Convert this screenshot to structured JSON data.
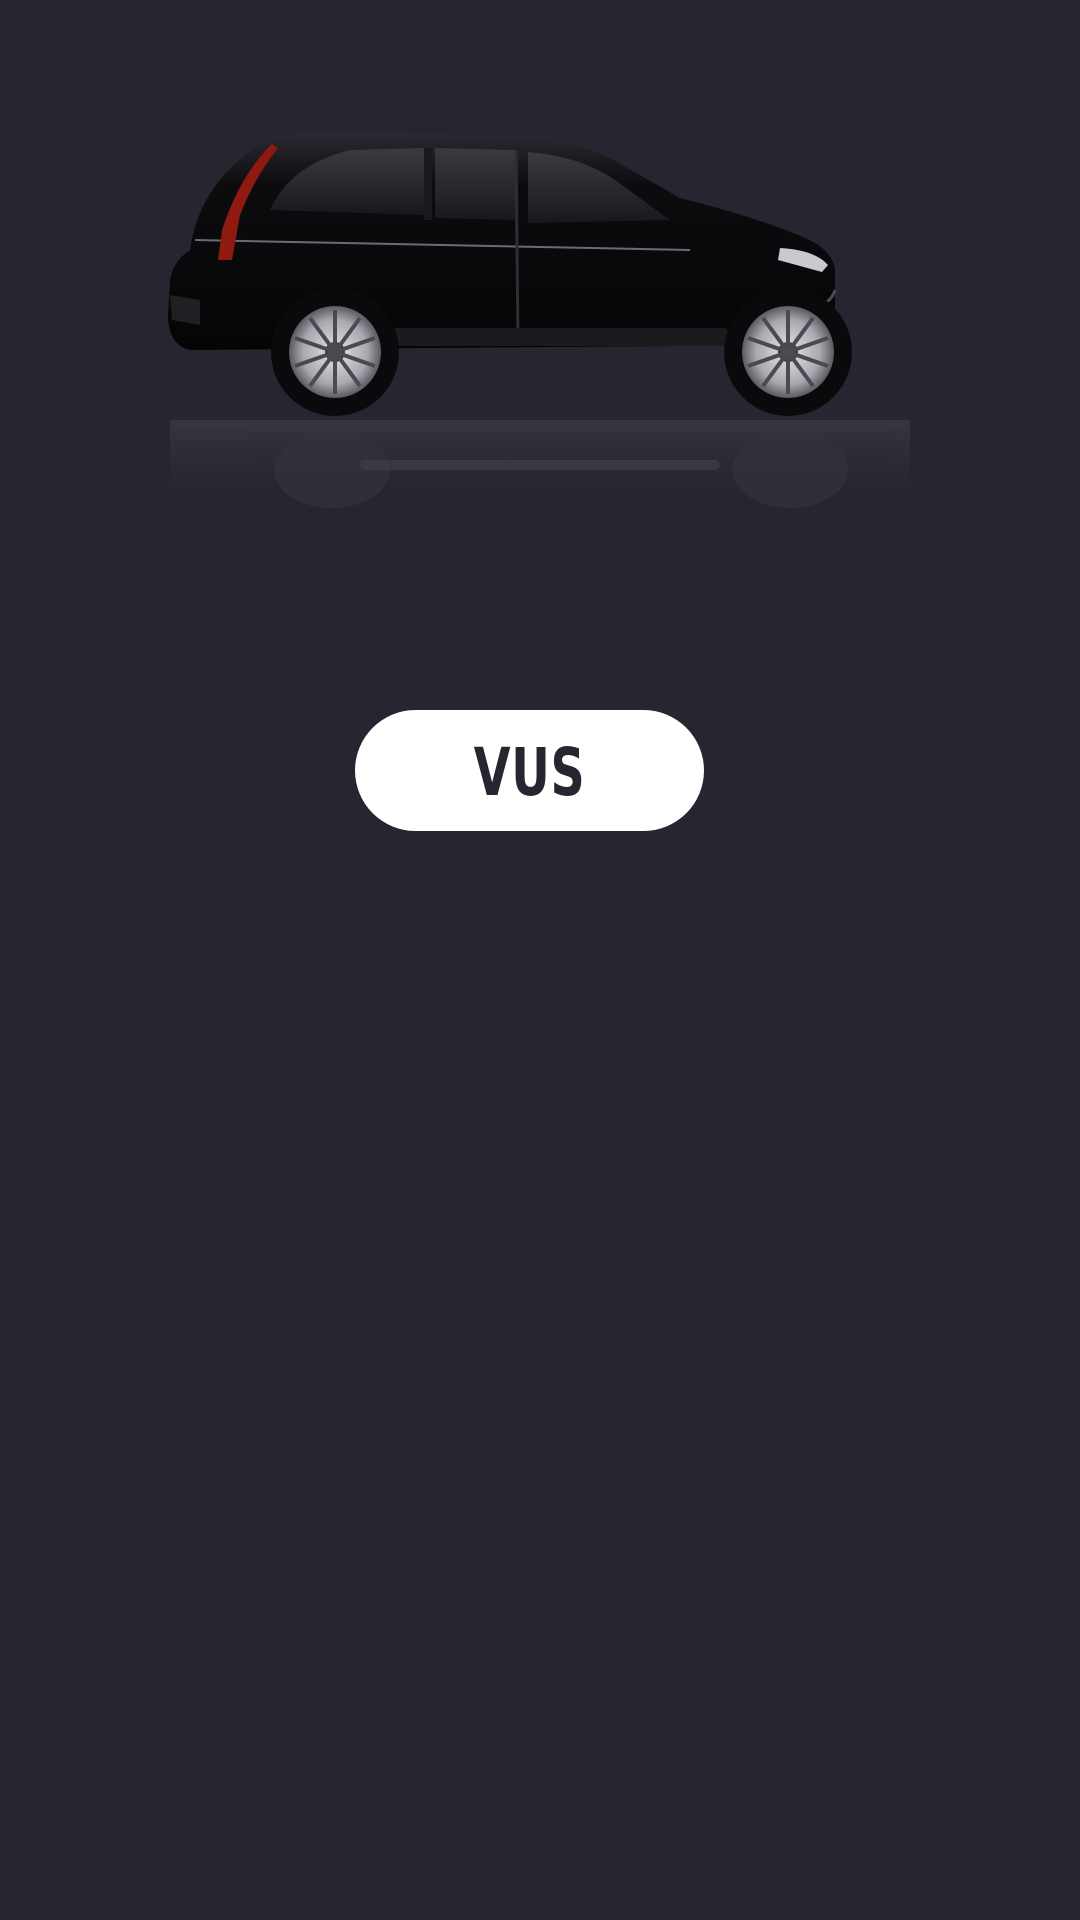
{
  "colors": {
    "background": "#262631",
    "button_background": "#ffffff",
    "button_text": "#262631",
    "car_body": "#0b0b0d",
    "tail_light": "#8e1a12"
  },
  "hero": {
    "image": "black-suv-side-view-with-reflection"
  },
  "brand_button": {
    "label": "VUS"
  }
}
